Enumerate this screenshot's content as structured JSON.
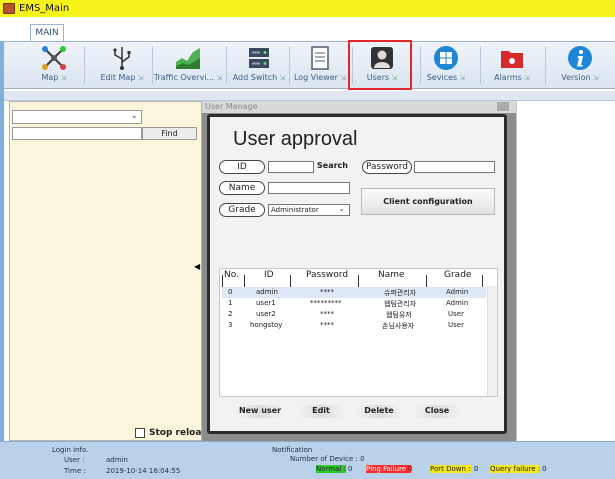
{
  "window": {
    "title": "EMS_Main"
  },
  "ribbon": {
    "tab": "MAIN",
    "buttons": [
      {
        "label": "Map",
        "icon": "network-map-icon"
      },
      {
        "label": "Edit Map",
        "icon": "usb-tree-icon"
      },
      {
        "label": "Traffic Overvi...",
        "icon": "area-chart-icon"
      },
      {
        "label": "Add Switch",
        "icon": "server-icon"
      },
      {
        "label": "Log Viewer",
        "icon": "document-icon"
      },
      {
        "label": "Users",
        "icon": "user-icon"
      },
      {
        "label": "Sevices",
        "icon": "windows-icon"
      },
      {
        "label": "Alarms",
        "icon": "alarm-folder-icon"
      },
      {
        "label": "Version",
        "icon": "info-icon"
      }
    ]
  },
  "left_panel": {
    "select_value": "",
    "search_value": "",
    "find_label": "Find",
    "stop_reload_label": "Stop reload"
  },
  "dialog": {
    "caption": "User Manage",
    "title": "User approval",
    "id_label": "ID",
    "id_value": "",
    "search_label": "Search",
    "password_label": "Password",
    "password_value": "",
    "name_label": "Name",
    "name_value": "",
    "grade_label": "Grade",
    "grade_value": "Administrator",
    "client_config_label": "Client configuration",
    "table": {
      "headers": [
        "No.",
        "ID",
        "Password",
        "Name",
        "Grade"
      ],
      "rows": [
        {
          "no": "0",
          "id": "admin",
          "password": "****",
          "name": "슈퍼관리자",
          "grade": "Admin"
        },
        {
          "no": "1",
          "id": "user1",
          "password": "*********",
          "name": "웹팀관리자",
          "grade": "Admin"
        },
        {
          "no": "2",
          "id": "user2",
          "password": "****",
          "name": "웹팀유저",
          "grade": "User"
        },
        {
          "no": "3",
          "id": "hongstoy",
          "password": "****",
          "name": "손님사용자",
          "grade": "User"
        }
      ]
    },
    "buttons": {
      "new_user": "New user",
      "edit": "Edit",
      "delete": "Delete",
      "close": "Close"
    }
  },
  "status": {
    "login_info": "Login info.",
    "user_label": "User :",
    "user_value": "admin",
    "time_label": "Time :",
    "time_value": "2019-10-14 16:04:55",
    "notification": "Notification",
    "device_count": "Number of Device : 0",
    "normal": {
      "label": "Normal :",
      "value": "0",
      "color": "#2fc92f"
    },
    "ping_failure": {
      "label": "Ping Failure :",
      "value": "0",
      "color": "#ff2b2b"
    },
    "port_down": {
      "label": "Port Down :",
      "value": "0",
      "color": "#f7e81a"
    },
    "query_failure": {
      "label": "Query failure :",
      "value": "0",
      "color": "#f7e81a"
    }
  },
  "colors": {
    "highlight": "#e0282b",
    "header_band": "#f7f21c",
    "status_bar": "#b9d2ea"
  }
}
